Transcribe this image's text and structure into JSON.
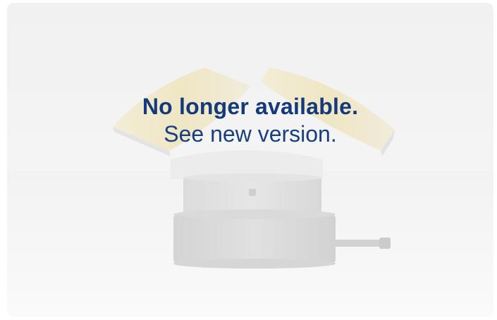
{
  "banner": {
    "headline": "No longer available.",
    "link_text": "See new version.",
    "text_color": "#143a7a",
    "image_subject": "rotary-mount-with-angled-mirrors"
  }
}
